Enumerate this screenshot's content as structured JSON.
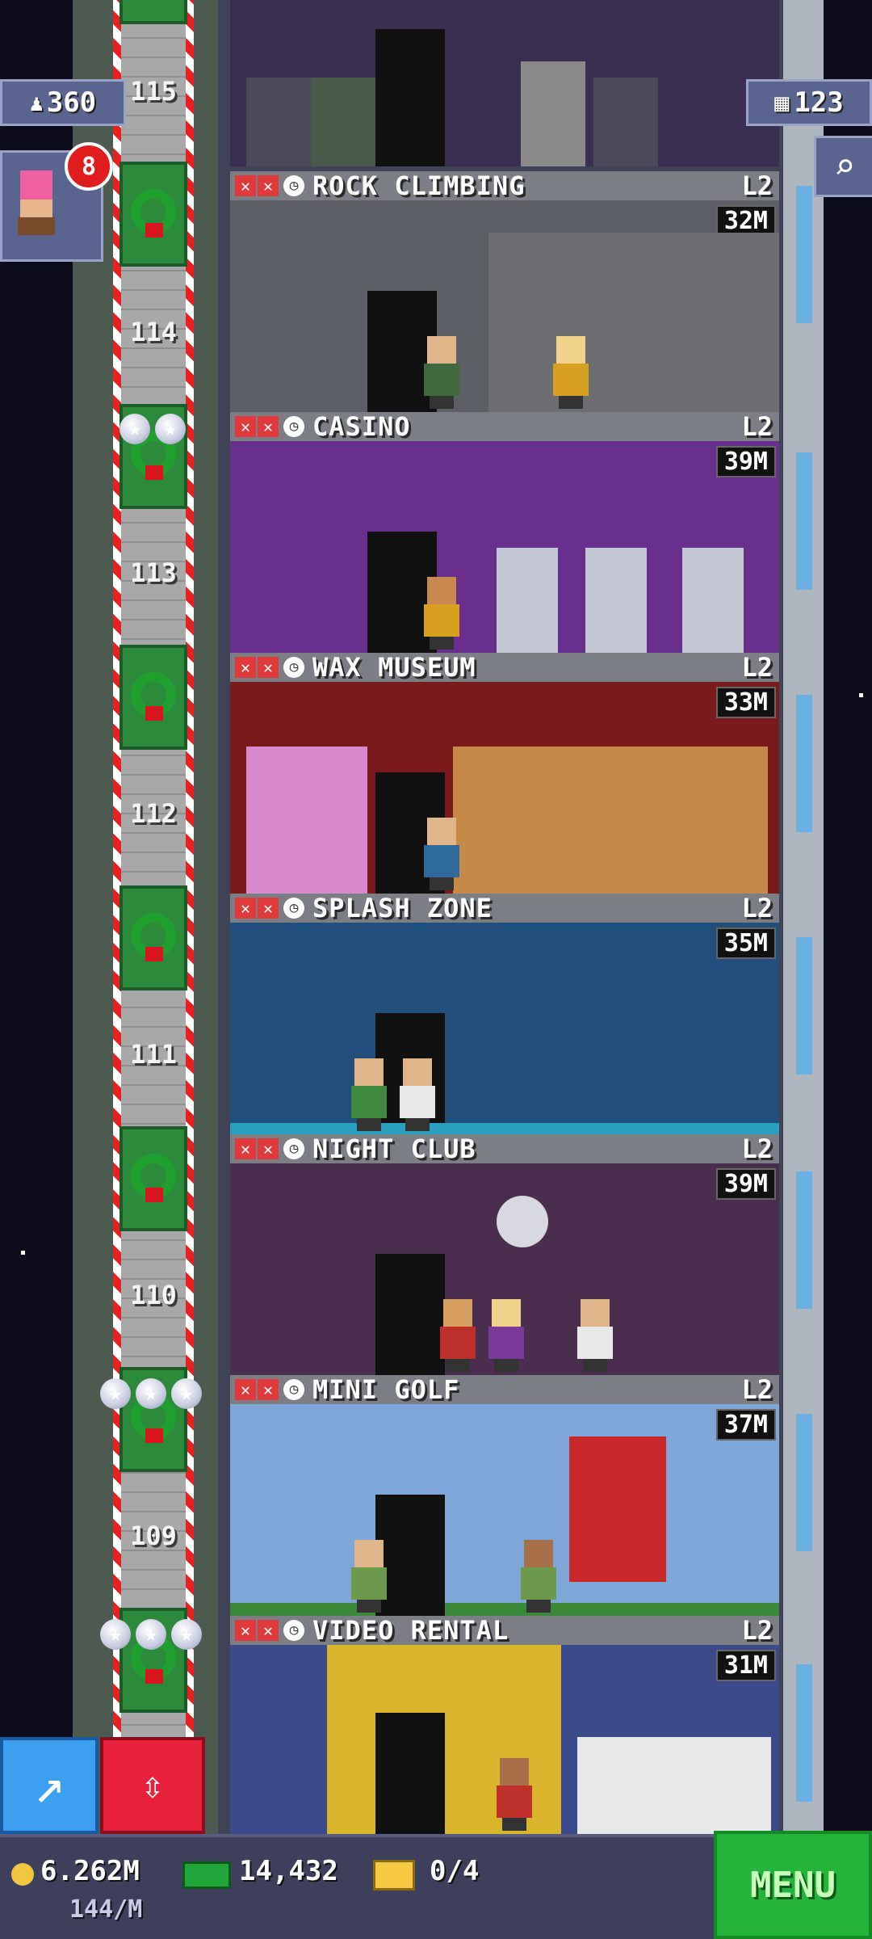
{
  "hud": {
    "population": "360",
    "floor_count": "123",
    "notification_count": "8",
    "coins": "6.262M",
    "coin_rate": "144/M",
    "bux": "14,432",
    "vip_tickets": "0/4",
    "menu_label": "MENU"
  },
  "elevator": {
    "floor_labels": [
      "115",
      "114",
      "113",
      "112",
      "111",
      "110",
      "109"
    ]
  },
  "rooms": [
    {
      "name": "ROCK CLIMBING",
      "level": "L2",
      "income": "32M",
      "color": "#5d5f66"
    },
    {
      "name": "CASINO",
      "level": "L2",
      "income": "39M",
      "color": "#6a2f8c"
    },
    {
      "name": "WAX MUSEUM",
      "level": "L2",
      "income": "33M",
      "color": "#7a1a1a"
    },
    {
      "name": "SPLASH ZONE",
      "level": "L2",
      "income": "35M",
      "color": "#1f4f7a"
    },
    {
      "name": "NIGHT CLUB",
      "level": "L2",
      "income": "39M",
      "color": "#4a2d4f"
    },
    {
      "name": "MINI GOLF",
      "level": "L2",
      "income": "37M",
      "color": "#7fa6d8"
    },
    {
      "name": "VIDEO RENTAL",
      "level": "L2",
      "income": "31M",
      "color": "#d8b52a"
    }
  ],
  "icons": {
    "population": "person-icon",
    "floors": "building-icon",
    "search": "magnifier-icon",
    "coins": "coin-icon",
    "bux": "bux-icon",
    "vip": "ticket-icon",
    "up": "arrow-up-icon",
    "elevator": "elevator-arrows-icon"
  }
}
